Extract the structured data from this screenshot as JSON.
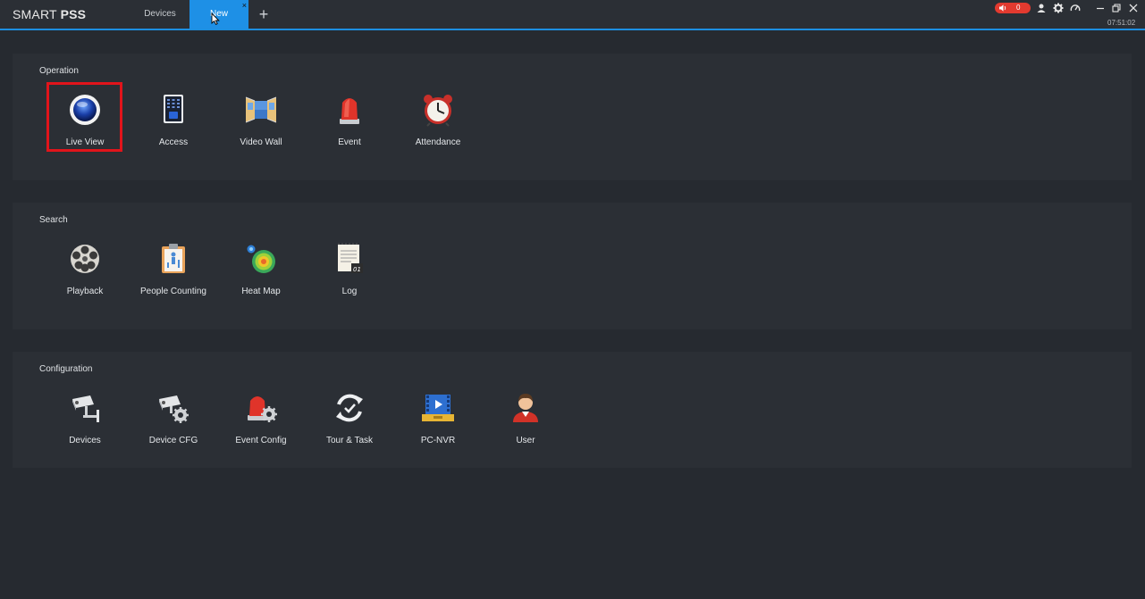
{
  "app": {
    "title_light": "SMART",
    "title_bold": "PSS"
  },
  "tabs": [
    {
      "label": "Devices",
      "active": false
    },
    {
      "label": "New",
      "active": true
    }
  ],
  "tab_close_glyph": "×",
  "add_tab_glyph": "+",
  "alarm": {
    "count": "0",
    "color": "#e33a2f"
  },
  "toolbar_icons": [
    "user-icon",
    "gear-icon",
    "performance-icon",
    "minimize-icon",
    "restore-icon",
    "close-icon"
  ],
  "clock": "07:51:02",
  "accent_color": "#1e90e6",
  "highlight_color": "#e1141b",
  "sections": {
    "operation": {
      "title": "Operation",
      "items": [
        {
          "label": "Live View",
          "icon": "live-view-icon",
          "highlighted": true
        },
        {
          "label": "Access",
          "icon": "access-control-icon"
        },
        {
          "label": "Video Wall",
          "icon": "video-wall-icon"
        },
        {
          "label": "Event",
          "icon": "alarm-siren-icon"
        },
        {
          "label": "Attendance",
          "icon": "alarm-clock-icon"
        }
      ]
    },
    "search": {
      "title": "Search",
      "items": [
        {
          "label": "Playback",
          "icon": "film-reel-icon"
        },
        {
          "label": "People Counting",
          "icon": "people-counting-icon"
        },
        {
          "label": "Heat Map",
          "icon": "heat-map-icon"
        },
        {
          "label": "Log",
          "icon": "log-calendar-icon"
        }
      ]
    },
    "configuration": {
      "title": "Configuration",
      "items": [
        {
          "label": "Devices",
          "icon": "camera-devices-icon"
        },
        {
          "label": "Device CFG",
          "icon": "camera-config-icon"
        },
        {
          "label": "Event Config",
          "icon": "siren-config-icon"
        },
        {
          "label": "Tour & Task",
          "icon": "tour-cycle-icon"
        },
        {
          "label": "PC-NVR",
          "icon": "pc-nvr-icon"
        },
        {
          "label": "User",
          "icon": "user-avatar-icon"
        }
      ]
    }
  }
}
